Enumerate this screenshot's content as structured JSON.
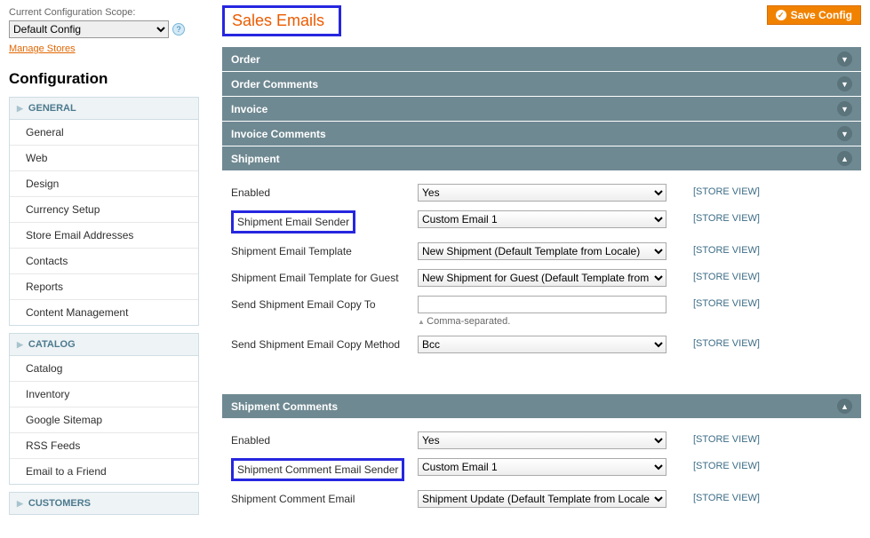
{
  "sidebar": {
    "scope_label": "Current Configuration Scope:",
    "scope_value": "Default Config",
    "manage_stores": "Manage Stores",
    "title": "Configuration",
    "groups": [
      {
        "name": "GENERAL",
        "items": [
          "General",
          "Web",
          "Design",
          "Currency Setup",
          "Store Email Addresses",
          "Contacts",
          "Reports",
          "Content Management"
        ]
      },
      {
        "name": "CATALOG",
        "items": [
          "Catalog",
          "Inventory",
          "Google Sitemap",
          "RSS Feeds",
          "Email to a Friend"
        ]
      },
      {
        "name": "CUSTOMERS",
        "items": []
      }
    ]
  },
  "header": {
    "title": "Sales Emails",
    "save_label": "Save Config"
  },
  "scope_text": "[STORE VIEW]",
  "sections": {
    "order": "Order",
    "order_comments": "Order Comments",
    "invoice": "Invoice",
    "invoice_comments": "Invoice Comments",
    "shipment": "Shipment",
    "shipment_comments": "Shipment Comments"
  },
  "shipment": {
    "enabled_label": "Enabled",
    "enabled_value": "Yes",
    "sender_label": "Shipment Email Sender",
    "sender_value": "Custom Email 1",
    "template_label": "Shipment Email Template",
    "template_value": "New Shipment (Default Template from Locale)",
    "template_guest_label": "Shipment Email Template for Guest",
    "template_guest_value": "New Shipment for Guest (Default Template from",
    "copy_to_label": "Send Shipment Email Copy To",
    "copy_to_value": "",
    "copy_to_hint": "Comma-separated.",
    "copy_method_label": "Send Shipment Email Copy Method",
    "copy_method_value": "Bcc"
  },
  "shipment_comments": {
    "enabled_label": "Enabled",
    "enabled_value": "Yes",
    "sender_label": "Shipment Comment Email Sender",
    "sender_value": "Custom Email 1",
    "template_label": "Shipment Comment Email",
    "template_value": "Shipment Update (Default Template from Locale"
  }
}
